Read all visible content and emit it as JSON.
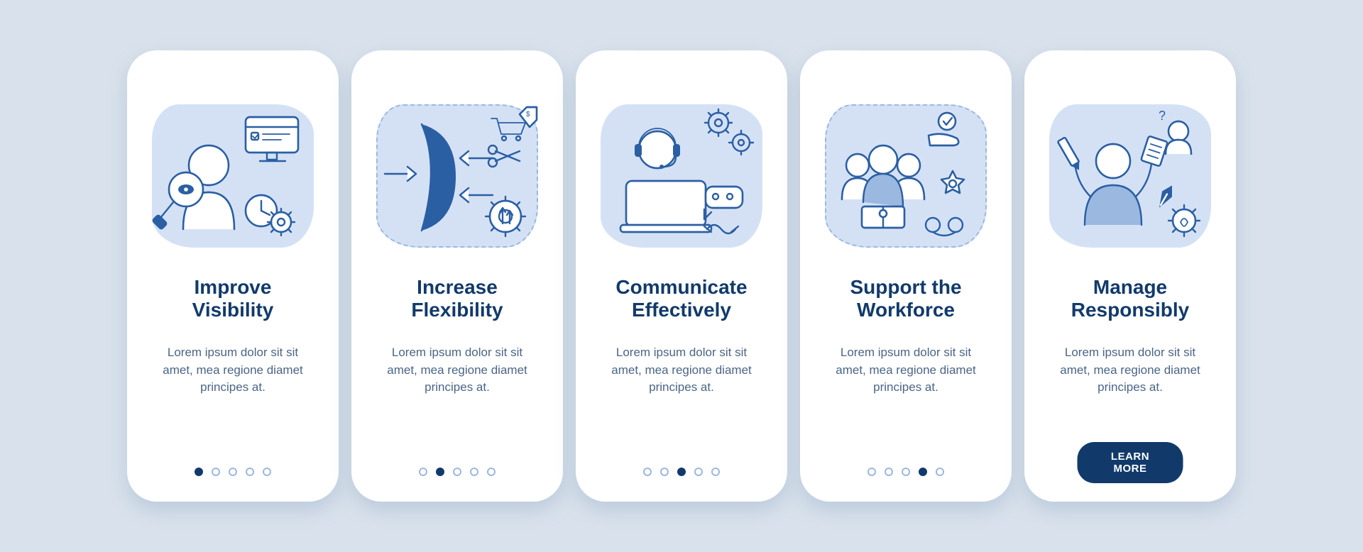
{
  "colors": {
    "background": "#d9e2ec",
    "card": "#ffffff",
    "heading": "#123a6b",
    "body_text": "#4a6585",
    "illus_light": "#d4e1f5",
    "illus_mid": "#9bb8e0",
    "illus_dark": "#2b5fa3",
    "navy": "#113a6b"
  },
  "common": {
    "description": "Lorem ipsum dolor sit sit amet, mea regione diamet principes at.",
    "dots_count": 5
  },
  "slides": [
    {
      "title": "Improve Visibility",
      "active_dot_index": 0,
      "icon": "visibility-illustration",
      "has_cta": false
    },
    {
      "title": "Increase Flexibility",
      "active_dot_index": 1,
      "icon": "flexibility-illustration",
      "has_cta": false
    },
    {
      "title": "Communicate Effectively",
      "active_dot_index": 2,
      "icon": "communicate-illustration",
      "has_cta": false
    },
    {
      "title": "Support the Workforce",
      "active_dot_index": 3,
      "icon": "workforce-illustration",
      "has_cta": false
    },
    {
      "title": "Manage Responsibly",
      "active_dot_index": 4,
      "icon": "manage-illustration",
      "has_cta": true
    }
  ],
  "cta": {
    "label": "LEARN MORE"
  }
}
